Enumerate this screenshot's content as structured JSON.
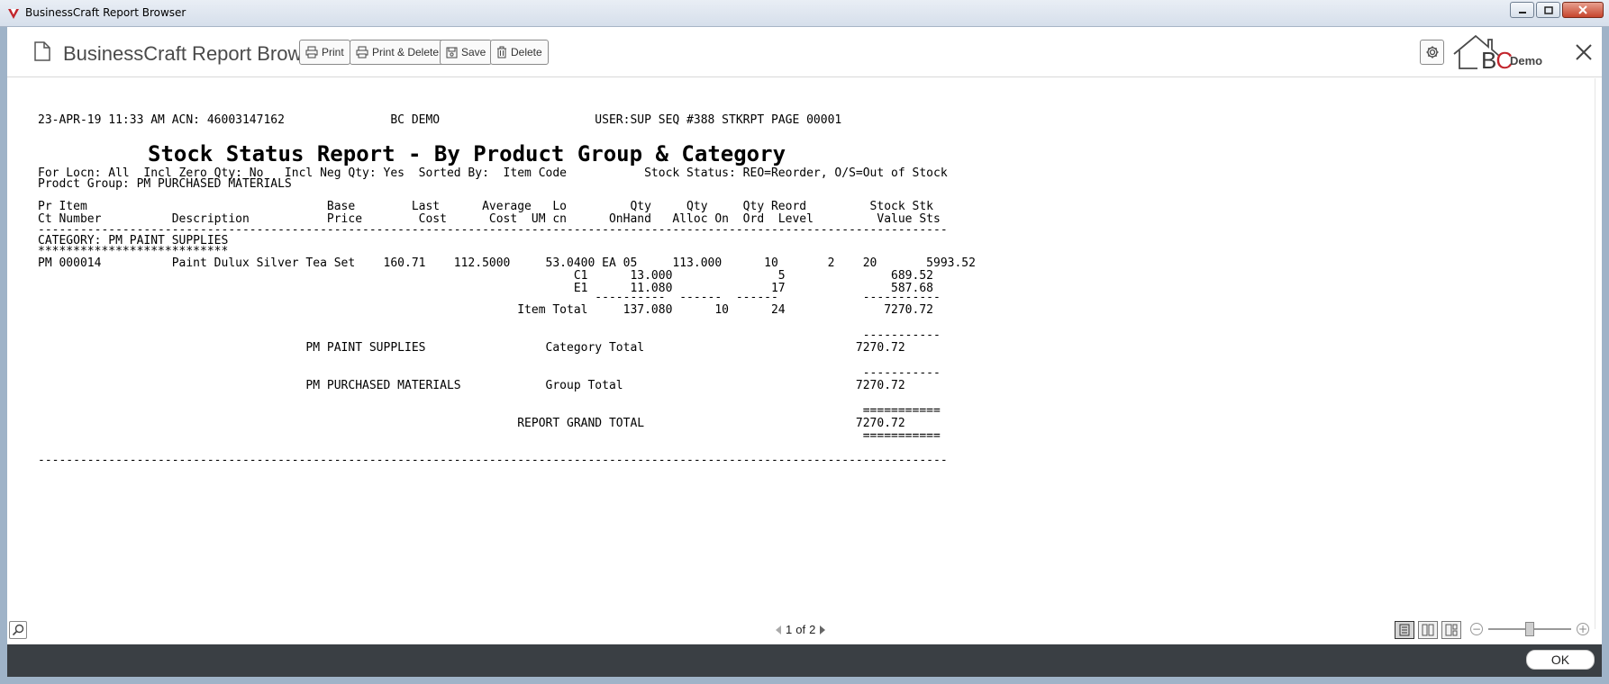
{
  "window": {
    "title": "BusinessCraft Report Browser"
  },
  "toolbar": {
    "app_title": "BusinessCraft Report Browser",
    "print_label": "Print",
    "print_delete_label": "Print & Delete",
    "save_label": "Save",
    "delete_label": "Delete",
    "brand_text": "BC",
    "brand_b": "B",
    "brand_c": "C",
    "company_name": "Demo"
  },
  "report": {
    "header_line": "23-APR-19 11:33 AM ACN: 46003147162               BC DEMO                      USER:SUP SEQ #388 STKRPT PAGE 00001",
    "title": "Stock Status Report - By Product Group & Category",
    "params_line": "For Locn: All  Incl Zero Qty: No   Incl Neg Qty: Yes  Sorted By:  Item Code           Stock Status: REO=Reorder, O/S=Out of Stock",
    "group_line": "Prodct Group: PM PURCHASED MATERIALS",
    "col_header_1": "Pr Item                                  Base        Last      Average   Lo         Qty     Qty     Qty Reord         Stock Stk",
    "col_header_2": "Ct Number          Description           Price        Cost      Cost  UM cn      OnHand   Alloc On  Ord  Level         Value Sts",
    "rule": "---------------------------------------------------------------------------------------------------------------------------------",
    "category_line": "CATEGORY: PM PAINT SUPPLIES",
    "category_stars": "***************************",
    "item_line_1": "PM 000014          Paint Dulux Silver Tea Set    160.71    112.5000     53.0400 EA 05     113.000      10       2    20       5993.52",
    "item_line_2": "                                                                            C1      13.000               5               689.52",
    "item_line_3": "                                                                            E1      11.080              17               587.68",
    "subrule_1": "                                                                               ----------  ------  ------            -----------",
    "item_total": "                                                                    Item Total     137.080      10      24              7270.72",
    "subrule_2": "                                                                                                                     -----------",
    "category_total": "                                      PM PAINT SUPPLIES                 Category Total                              7270.72",
    "subrule_3": "                                                                                                                     -----------",
    "group_total": "                                      PM PURCHASED MATERIALS            Group Total                                 7270.72",
    "grand_rule_1": "                                                                                                                     ===========",
    "grand_total": "                                                                    REPORT GRAND TOTAL                              7270.72",
    "grand_rule_2": "                                                                                                                     ===========",
    "end_rule": "---------------------------------------------------------------------------------------------------------------------------------"
  },
  "footer": {
    "page_current": "1",
    "page_of": "of",
    "page_total": "2",
    "zoom_level": 0.5
  },
  "bottom": {
    "ok_label": "OK"
  },
  "colors": {
    "brand_red": "#c2252c",
    "bottom_bar": "#3a3f44"
  }
}
